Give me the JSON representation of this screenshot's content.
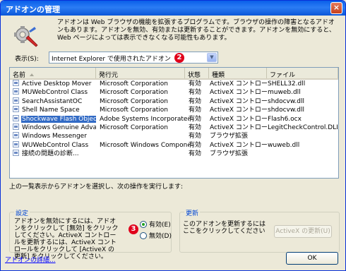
{
  "window": {
    "title": "アドオンの管理",
    "close_label": "×"
  },
  "intro": {
    "text": "アドオンは Web ブラウザの機能を拡張するプログラムです。ブラウザの操作の障害となるアドオンもあります。アドオンを無効、有効または更新することができます。アドオンを無効にすると、Web ページによっては表示できなくなる可能性もあります。"
  },
  "filter": {
    "label": "表示(S):",
    "value": "Internet Explorer で使用されたアドオン",
    "options_indicator": "▼"
  },
  "callouts": {
    "first": "2",
    "second": "3"
  },
  "table": {
    "headers": [
      "名前",
      "発行元",
      "状態",
      "種類",
      "ファイル"
    ],
    "rows": [
      [
        "Active Desktop Mover",
        "Microsoft Corporation",
        "有効",
        "ActiveX コントロール",
        "SHELL32.dll"
      ],
      [
        "MUWebControl Class",
        "Microsoft Corporation",
        "有効",
        "ActiveX コントロール",
        "muweb.dll"
      ],
      [
        "SearchAssistantOC",
        "Microsoft Corporation",
        "有効",
        "ActiveX コントロール",
        "shdocvw.dll"
      ],
      [
        "Shell Name Space",
        "Microsoft Corporation",
        "有効",
        "ActiveX コントロール",
        "shdocvw.dll"
      ],
      [
        "Shockwave Flash Object",
        "Adobe Systems Incorporated",
        "有効",
        "ActiveX コントロール",
        "Flash6.ocx"
      ],
      [
        "Windows Genuine Advant...",
        "Microsoft Corporation",
        "有効",
        "ActiveX コントロール",
        "LegitCheckControl.DLL"
      ],
      [
        "Windows Messenger",
        "",
        "有効",
        "ブラウザ拡張",
        ""
      ],
      [
        "WUWebControl Class",
        "Microsoft Windows Compone...",
        "有効",
        "ActiveX コントロール",
        "wuweb.dll"
      ],
      [
        "接続の問題の診断...",
        "",
        "有効",
        "ブラウザ拡張",
        ""
      ]
    ],
    "selected_row": 4
  },
  "action_text": "上の一覧表示からアドオンを選択し、次の操作を実行します:",
  "settings": {
    "legend": "設定",
    "text": "アドオンを無効にするには、アドオンをクリックして [無効] をクリックしてください。ActiveX コントロールを更新するには、ActiveX コントロールをクリックして [ActiveX の更新] をクリックしてください。",
    "enable_label": "有効(E)",
    "disable_label": "無効(D)",
    "selected": "enable"
  },
  "update": {
    "legend": "更新",
    "text": "このアドオンを更新するにはここをクリックしてください",
    "button_label": "ActiveX の更新(U)"
  },
  "footer": {
    "link_label": "アドオンの詳細...",
    "ok_label": "OK"
  }
}
